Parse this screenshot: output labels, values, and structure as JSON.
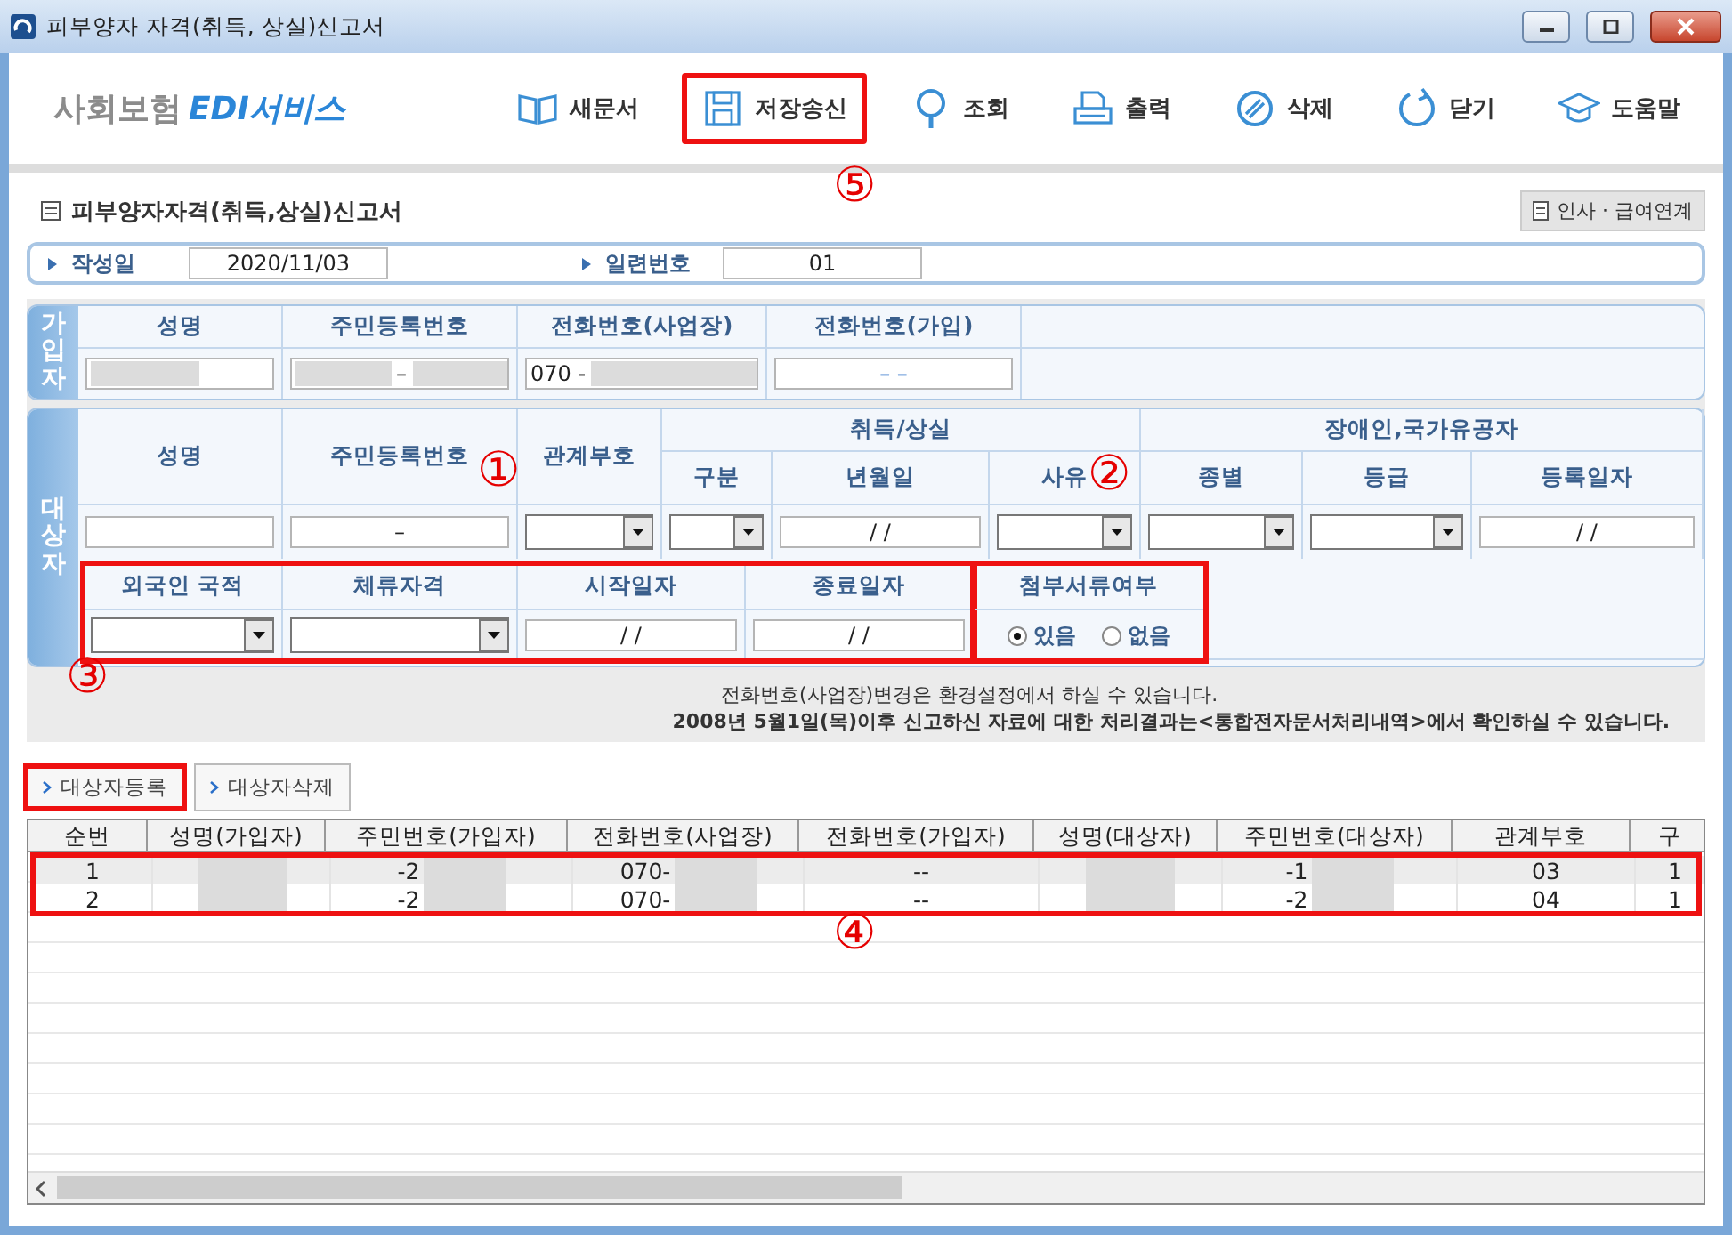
{
  "window": {
    "title": "피부양자 자격(취득, 상실)신고서"
  },
  "logo": [
    {
      "text": "사회보험",
      "kind": "plain"
    },
    {
      "text": "EDI서비스",
      "kind": "accent"
    }
  ],
  "toolbar": [
    {
      "label": "새문서",
      "kind": "book",
      "highlighted": false
    },
    {
      "label": "저장송신",
      "kind": "disk",
      "highlighted": true
    },
    {
      "label": "조회",
      "kind": "lookup",
      "highlighted": false
    },
    {
      "label": "출력",
      "kind": "printer",
      "highlighted": false
    },
    {
      "label": "삭제",
      "kind": "erase",
      "highlighted": false
    },
    {
      "label": "닫기",
      "kind": "refresh",
      "highlighted": false
    },
    {
      "label": "도움말",
      "kind": "cap",
      "highlighted": false
    }
  ],
  "form_title": "피부양자자격(취득,상실)신고서",
  "link_button": "인사 · 급여연계",
  "header_fields": [
    {
      "label": "작성일",
      "value": "2020/11/03"
    },
    {
      "label": "일련번호",
      "value": "01"
    }
  ],
  "subscriber": {
    "section_label": "가입자",
    "columns": [
      "성명",
      "주민등록번호",
      "전화번호(사업장)",
      "전화번호(가입)"
    ],
    "fields": [
      {
        "kind": "masked"
      },
      {
        "kind": "split",
        "value": "–"
      },
      {
        "kind": "prefix",
        "value": "070  -"
      },
      {
        "kind": "plain",
        "value": "–        –"
      }
    ]
  },
  "dependent": {
    "section_label": "대상자",
    "columns": [
      {
        "label": "성명",
        "kind": "text"
      },
      {
        "label": "주민등록번호",
        "kind": "text",
        "value": "–"
      },
      {
        "label": "관계부호",
        "kind": "select"
      },
      {
        "group": "취득/상실",
        "columns": [
          {
            "label": "구분",
            "kind": "select"
          },
          {
            "label": "년월일",
            "kind": "text",
            "value": "/ /"
          },
          {
            "label": "사유",
            "kind": "select"
          }
        ]
      },
      {
        "group": "장애인,국가유공자",
        "columns": [
          {
            "label": "종별",
            "kind": "select"
          },
          {
            "label": "등급",
            "kind": "select"
          },
          {
            "label": "등록일자",
            "kind": "text",
            "value": "/ /"
          }
        ]
      }
    ],
    "foreign": {
      "highlighted": true,
      "columns": [
        {
          "label": "외국인 국적",
          "kind": "select"
        },
        {
          "label": "체류자격",
          "kind": "select"
        },
        {
          "label": "시작일자",
          "kind": "text",
          "value": "/ /"
        },
        {
          "label": "종료일자",
          "kind": "text",
          "value": "/ /"
        }
      ]
    },
    "attachment": {
      "highlighted": true,
      "label": "첨부서류여부",
      "options": [
        {
          "label": "있음",
          "selected": true
        },
        {
          "label": "없음",
          "selected": false
        }
      ]
    }
  },
  "notes": [
    {
      "text": "전화번호(사업장)변경은 환경설정에서 하실 수 있습니다.",
      "bold": false
    },
    {
      "text": "2008년 5월1일(목)이후 신고하신 자료에 대한 처리결과는<통합전자문서처리내역>에서 확인하실 수 있습니다.",
      "bold": true
    }
  ],
  "buttons": [
    {
      "label": "대상자등록",
      "highlighted": true
    },
    {
      "label": "대상자삭제",
      "highlighted": false
    }
  ],
  "grid": {
    "highlighted": true,
    "columns": [
      "순번",
      "성명(가입자)",
      "주민번호(가입자)",
      "전화번호(사업장)",
      "전화번호(가입자)",
      "성명(대상자)",
      "주민번호(대상자)",
      "관계부호",
      "구"
    ],
    "rows": [
      {
        "selected": true,
        "cells": [
          {
            "text": "1"
          },
          {
            "masked": true
          },
          {
            "text": "-2",
            "masked": true
          },
          {
            "text": "070-",
            "masked": true
          },
          {
            "text": "--"
          },
          {
            "masked": true
          },
          {
            "text": "-1",
            "masked": true
          },
          {
            "text": "03"
          },
          {
            "text": "1"
          }
        ]
      },
      {
        "selected": false,
        "cells": [
          {
            "text": "2"
          },
          {
            "masked": true
          },
          {
            "text": "-2",
            "masked": true
          },
          {
            "text": "070-",
            "masked": true
          },
          {
            "text": "--"
          },
          {
            "masked": true
          },
          {
            "text": "-2",
            "masked": true
          },
          {
            "text": "04"
          },
          {
            "text": "1"
          }
        ]
      }
    ]
  },
  "callouts": [
    "①",
    "②",
    "③",
    "④",
    "⑤"
  ]
}
